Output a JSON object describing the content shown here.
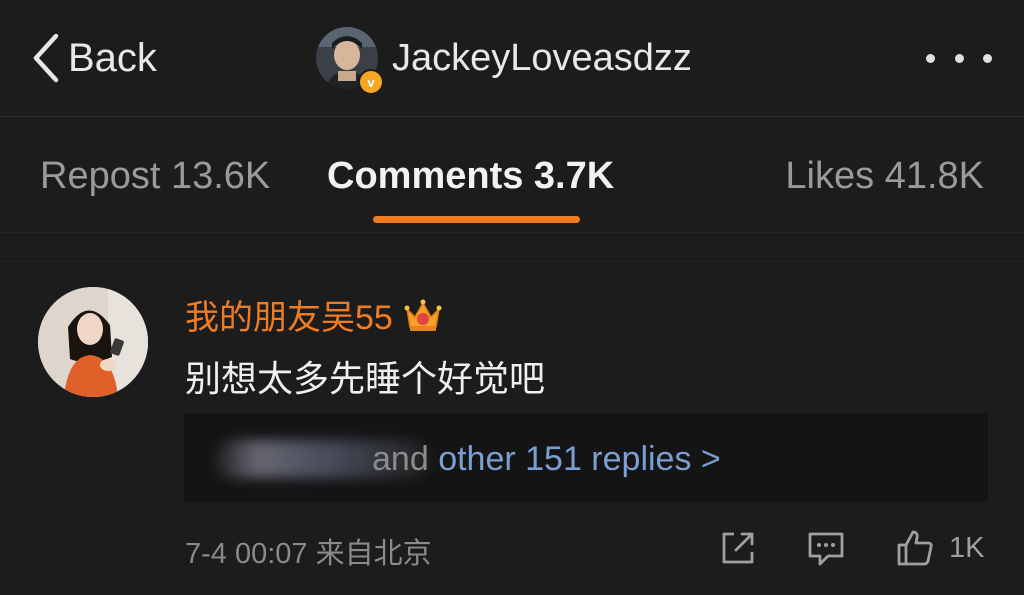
{
  "header": {
    "back_label": "Back",
    "username": "JackeyLoveasdzz",
    "verified_badge": "v",
    "icons": [
      "chevron-left-icon",
      "verified-icon",
      "more-dots-icon"
    ]
  },
  "tabs": {
    "repost": "Repost 13.6K",
    "comments": "Comments 3.7K",
    "likes": "Likes 41.8K",
    "active": "comments",
    "accent_color": "#f07c22"
  },
  "comment": {
    "author": "我的朋友吴55",
    "author_color": "#f07c22",
    "badge_icon": "crown-icon",
    "text": "别想太多先睡个好觉吧",
    "replies_prefix": "and",
    "replies_link": "other 151 replies >",
    "timestamp": "7-4 00:07",
    "location": "来自北京",
    "like_count": "1K",
    "action_icons": [
      "share-icon",
      "comment-icon",
      "thumbs-up-icon"
    ]
  }
}
